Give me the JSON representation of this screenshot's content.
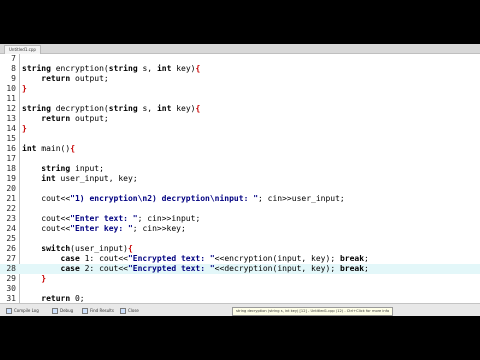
{
  "tab": {
    "label": "Untitled1.cpp"
  },
  "editor": {
    "lines": [
      {
        "num": "7",
        "code": ""
      },
      {
        "num": "8",
        "code": "string encryption(string s, int key){"
      },
      {
        "num": "9",
        "code": "    return output;"
      },
      {
        "num": "10",
        "code": "}"
      },
      {
        "num": "11",
        "code": ""
      },
      {
        "num": "12",
        "code": "string decryption(string s, int key){"
      },
      {
        "num": "13",
        "code": "    return output;"
      },
      {
        "num": "14",
        "code": "}"
      },
      {
        "num": "15",
        "code": ""
      },
      {
        "num": "16",
        "code": "int main(){"
      },
      {
        "num": "17",
        "code": ""
      },
      {
        "num": "18",
        "code": "    string input;"
      },
      {
        "num": "19",
        "code": "    int user_input, key;"
      },
      {
        "num": "20",
        "code": ""
      },
      {
        "num": "21",
        "code": "    cout<<\"1) encryption\\n2) decryption\\ninput: \"; cin>>user_input;"
      },
      {
        "num": "22",
        "code": ""
      },
      {
        "num": "23",
        "code": "    cout<<\"Enter text: \"; cin>>input;"
      },
      {
        "num": "24",
        "code": "    cout<<\"Enter key: \"; cin>>key;"
      },
      {
        "num": "25",
        "code": ""
      },
      {
        "num": "26",
        "code": "    switch(user_input){"
      },
      {
        "num": "27",
        "code": "        case 1: cout<<\"Encrypted text: \"<<encryption(input, key); break;"
      },
      {
        "num": "28",
        "code": "        case 2: cout<<\"Encrypted text: \"<<decryption(input, key); break;"
      },
      {
        "num": "29",
        "code": "    }"
      },
      {
        "num": "30",
        "code": ""
      },
      {
        "num": "31",
        "code": "    return 0;"
      }
    ]
  },
  "tooltip": {
    "text": "string decryption (string s, int key) [12] - Untitled1.cpp (12) - Ctrl+Click for more info"
  },
  "status": {
    "compile_log": "Compile Log",
    "debug": "Debug",
    "find_results": "Find Results",
    "close": "Close"
  },
  "colors": {
    "keyword": "#000000",
    "string": "#000080",
    "brace_marker": "#c80000",
    "current_line": "#e3f7f9"
  }
}
